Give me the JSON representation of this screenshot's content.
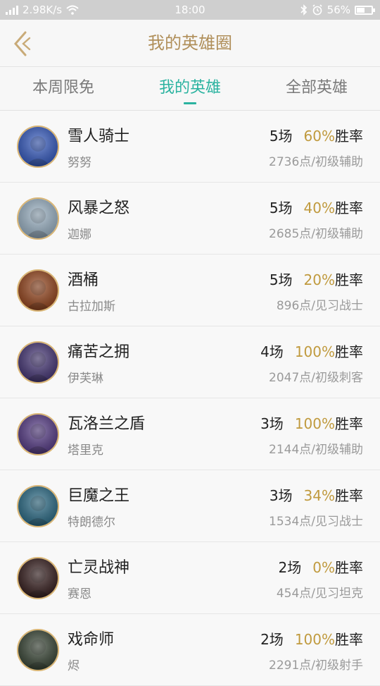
{
  "status_bar": {
    "network_speed": "2.98K/s",
    "time": "18:00",
    "battery_level": "56%",
    "battery_fraction": 0.56,
    "icons": [
      "signal-icon",
      "wifi-icon",
      "bluetooth-icon",
      "alarm-icon",
      "battery-icon"
    ]
  },
  "header": {
    "title": "我的英雄圈",
    "back_icon": "chevron-left-icon",
    "accent_color": "#b08f5a"
  },
  "tabs": [
    {
      "label": "本周限免",
      "active": false
    },
    {
      "label": "我的英雄",
      "active": true
    },
    {
      "label": "全部英雄",
      "active": false
    }
  ],
  "colors": {
    "tab_active": "#2bb3a0",
    "win_rate": "#c09a3e",
    "avatar_ring": "#d9b574"
  },
  "heroes": [
    {
      "name": "雪人骑士",
      "nickname": "努努",
      "games": "5场",
      "win_rate": "60%",
      "win_rate_label": "胜率",
      "level": "2736点/初级辅助",
      "avatar_color": "#3a5fc4"
    },
    {
      "name": "风暴之怒",
      "nickname": "迦娜",
      "games": "5场",
      "win_rate": "40%",
      "win_rate_label": "胜率",
      "level": "2685点/初级辅助",
      "avatar_color": "#9fb6c8"
    },
    {
      "name": "酒桶",
      "nickname": "古拉加斯",
      "games": "5场",
      "win_rate": "20%",
      "win_rate_label": "胜率",
      "level": "896点/见习战士",
      "avatar_color": "#9a4a22"
    },
    {
      "name": "痛苦之拥",
      "nickname": "伊芙琳",
      "games": "4场",
      "win_rate": "100%",
      "win_rate_label": "胜率",
      "level": "2047点/初级刺客",
      "avatar_color": "#4a3a7a"
    },
    {
      "name": "瓦洛兰之盾",
      "nickname": "塔里克",
      "games": "3场",
      "win_rate": "100%",
      "win_rate_label": "胜率",
      "level": "2144点/初级辅助",
      "avatar_color": "#5a3f8a"
    },
    {
      "name": "巨魔之王",
      "nickname": "特朗德尔",
      "games": "3场",
      "win_rate": "34%",
      "win_rate_label": "胜率",
      "level": "1534点/见习战士",
      "avatar_color": "#2f6f8a"
    },
    {
      "name": "亡灵战神",
      "nickname": "赛恩",
      "games": "2场",
      "win_rate": "0%",
      "win_rate_label": "胜率",
      "level": "454点/见习坦克",
      "avatar_color": "#3a2222"
    },
    {
      "name": "戏命师",
      "nickname": "烬",
      "games": "2场",
      "win_rate": "100%",
      "win_rate_label": "胜率",
      "level": "2291点/初级射手",
      "avatar_color": "#3d4a3a"
    }
  ]
}
